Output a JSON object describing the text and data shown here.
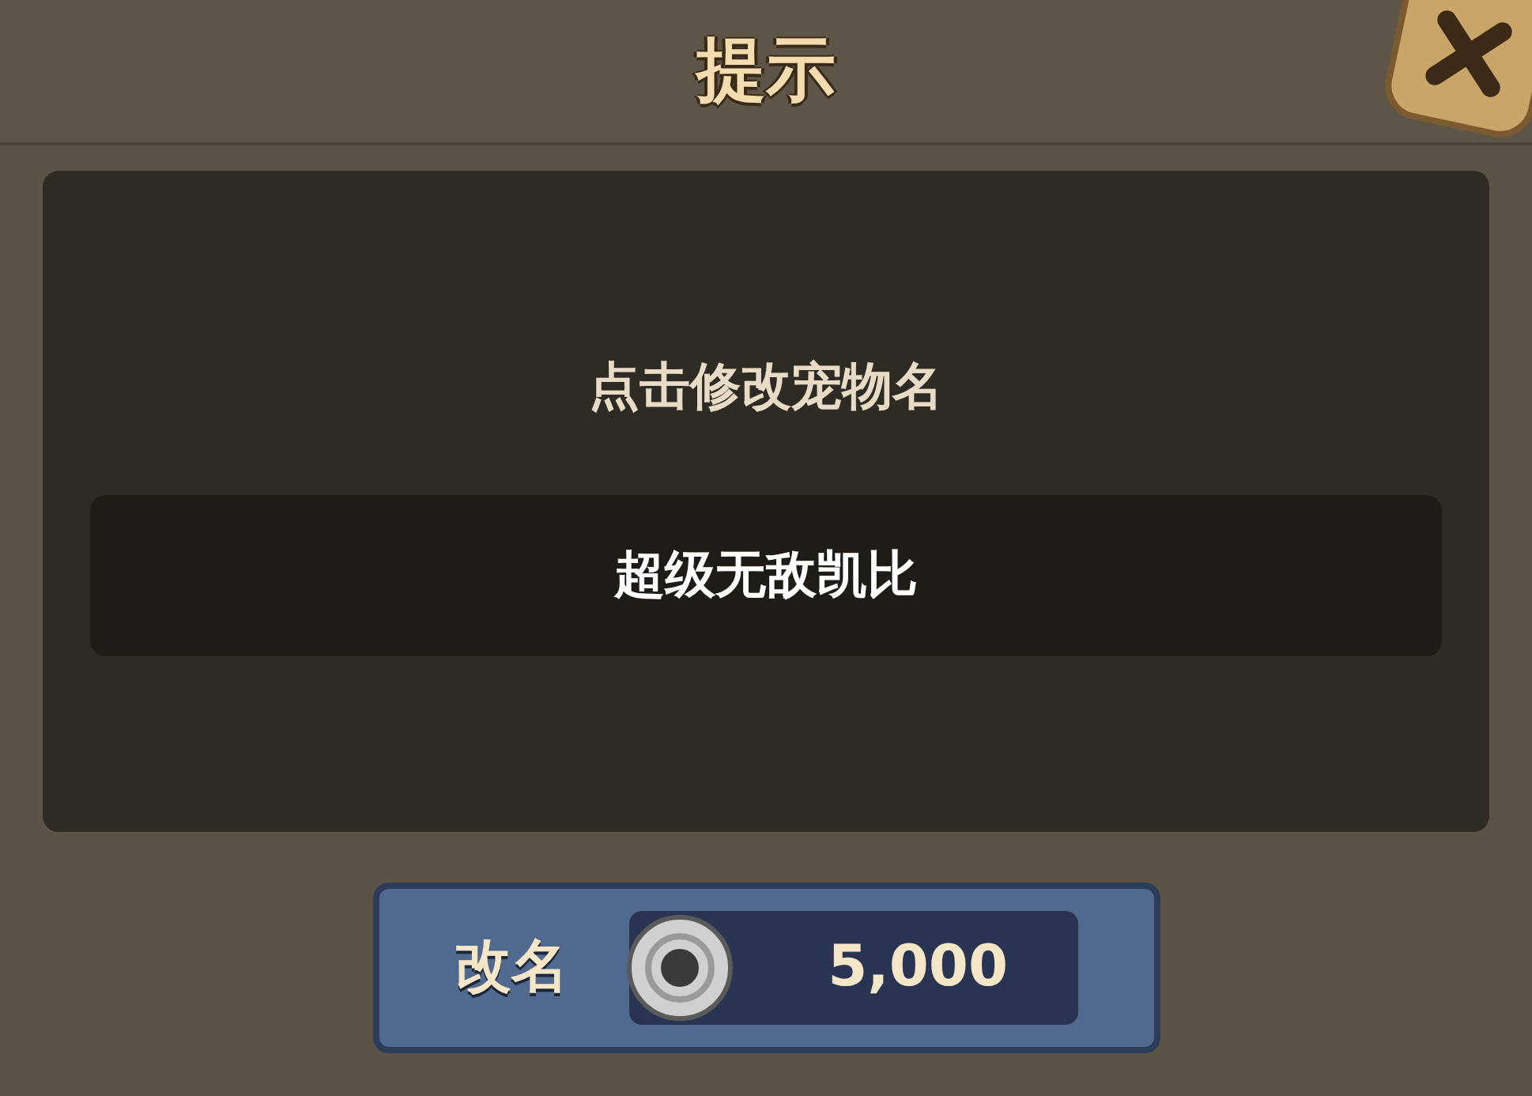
{
  "dialog": {
    "title": "提示"
  },
  "prompt": "点击修改宠物名",
  "name_field": {
    "value": "超级无敌凯比"
  },
  "rename_button": {
    "label": "改名",
    "cost": "5,000"
  }
}
